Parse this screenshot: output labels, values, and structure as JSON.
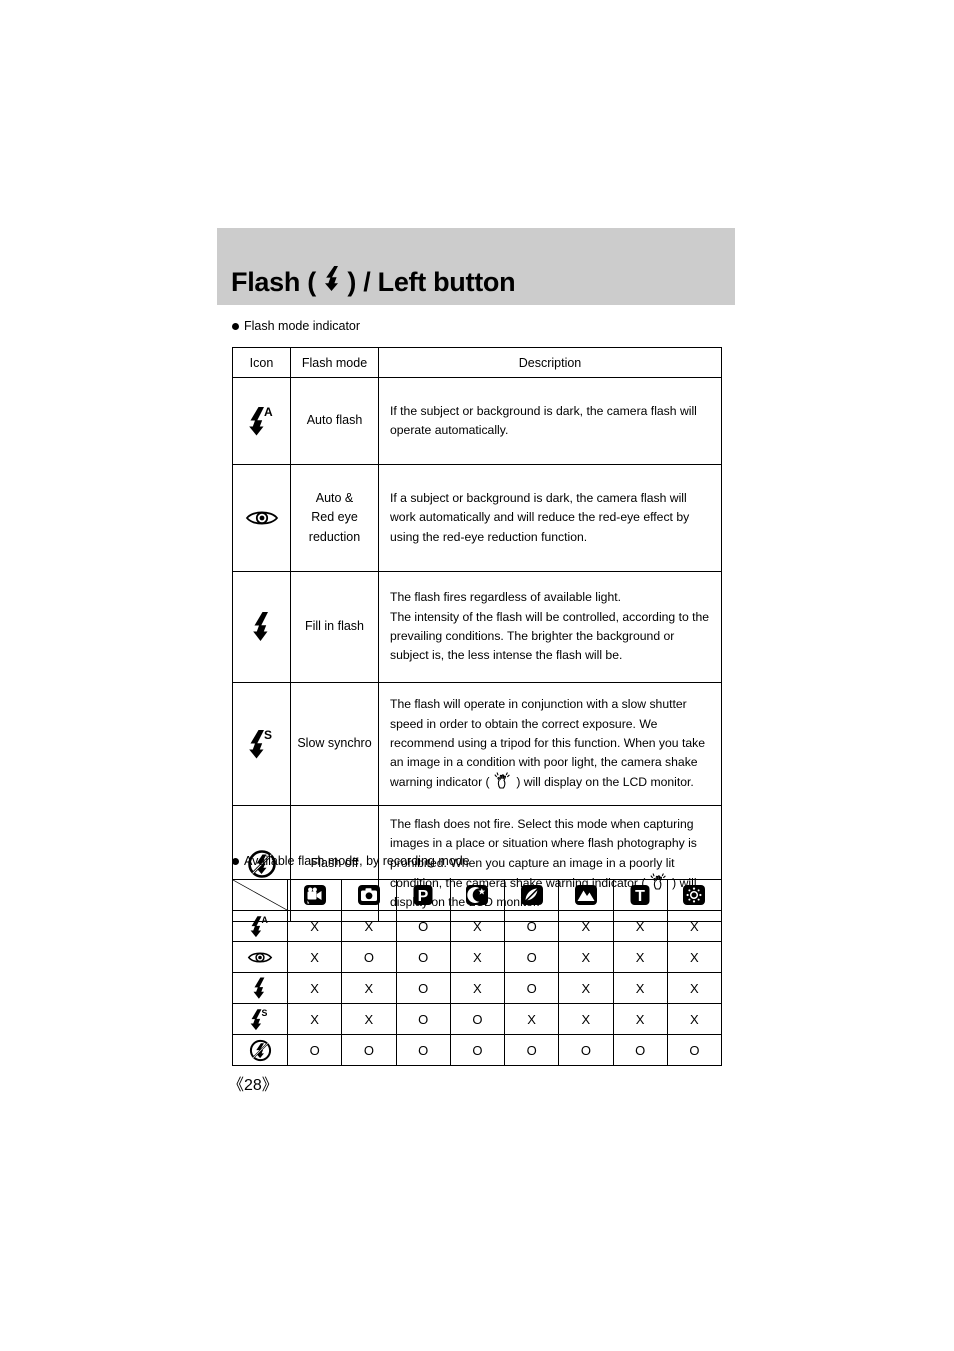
{
  "page": {
    "number": "《28》"
  },
  "header": {
    "title_prefix": "Flash ( ",
    "title_icon": "flash-bolt-icon",
    "title_suffix": " ) / Left button",
    "band_color": "#cccccc"
  },
  "section_1": {
    "bullet_label": "Flash mode indicator",
    "table": {
      "columns": [
        "Icon",
        "Flash mode",
        "Description"
      ],
      "rows": [
        {
          "icon": "flash-auto-icon",
          "mode": "Auto flash",
          "description": "If the subject or background is dark, the camera flash will operate automatically."
        },
        {
          "icon": "red-eye-icon",
          "mode": "Auto &\nRed eye\nreduction",
          "description": "If a subject or background is dark, the camera flash will work automatically and will reduce the red-eye effect by using the red-eye reduction function."
        },
        {
          "icon": "flash-fill-icon",
          "mode": "Fill in flash",
          "description": "The flash fires regardless of available light.\nThe intensity of the flash will be controlled, according to the prevailing conditions. The brighter the background or subject is, the less intense the flash will be."
        },
        {
          "icon": "flash-slow-sync-icon",
          "mode": "Slow synchro",
          "description_part_1": "The flash will operate in conjunction with a slow shutter speed in order to obtain the correct exposure. We recommend using a tripod for this function. When you take an image in a condition with poor light, the camera shake warning indicator ( ",
          "inline_icon": "camera-shake-warning-icon",
          "description_part_2": " ) will display on the LCD monitor."
        },
        {
          "icon": "flash-off-icon",
          "mode": "Flash off",
          "description_part_1": "The flash does not fire. Select this mode when capturing images in a place or situation where flash photography is prohibited. When you capture an image in a poorly lit condition, the camera shake warning indicator ( ",
          "inline_icon": "camera-shake-warning-icon",
          "description_part_2": " ) will display on the LCD monitor."
        }
      ]
    }
  },
  "section_2": {
    "bullet_label": "Available flash mode, by recording mode",
    "table": {
      "corner": "diagonal-divider",
      "recording_modes": [
        "movie-mode-icon",
        "still-image-mode-icon",
        "program-mode-icon",
        "night-scene-mode-icon",
        "portrait-mode-icon",
        "landscape-mode-icon",
        "text-mode-icon",
        "fireworks-mode-icon"
      ],
      "rows": [
        {
          "icon": "flash-auto-icon",
          "values": [
            "X",
            "X",
            "O",
            "X",
            "O",
            "X",
            "X",
            "X"
          ]
        },
        {
          "icon": "red-eye-icon",
          "values": [
            "X",
            "O",
            "O",
            "X",
            "O",
            "X",
            "X",
            "X"
          ]
        },
        {
          "icon": "flash-fill-icon",
          "values": [
            "X",
            "X",
            "O",
            "X",
            "O",
            "X",
            "X",
            "X"
          ]
        },
        {
          "icon": "flash-slow-sync-icon",
          "values": [
            "X",
            "X",
            "O",
            "O",
            "X",
            "X",
            "X",
            "X"
          ]
        },
        {
          "icon": "flash-off-icon",
          "values": [
            "O",
            "O",
            "O",
            "O",
            "O",
            "O",
            "O",
            "O"
          ]
        }
      ]
    }
  }
}
